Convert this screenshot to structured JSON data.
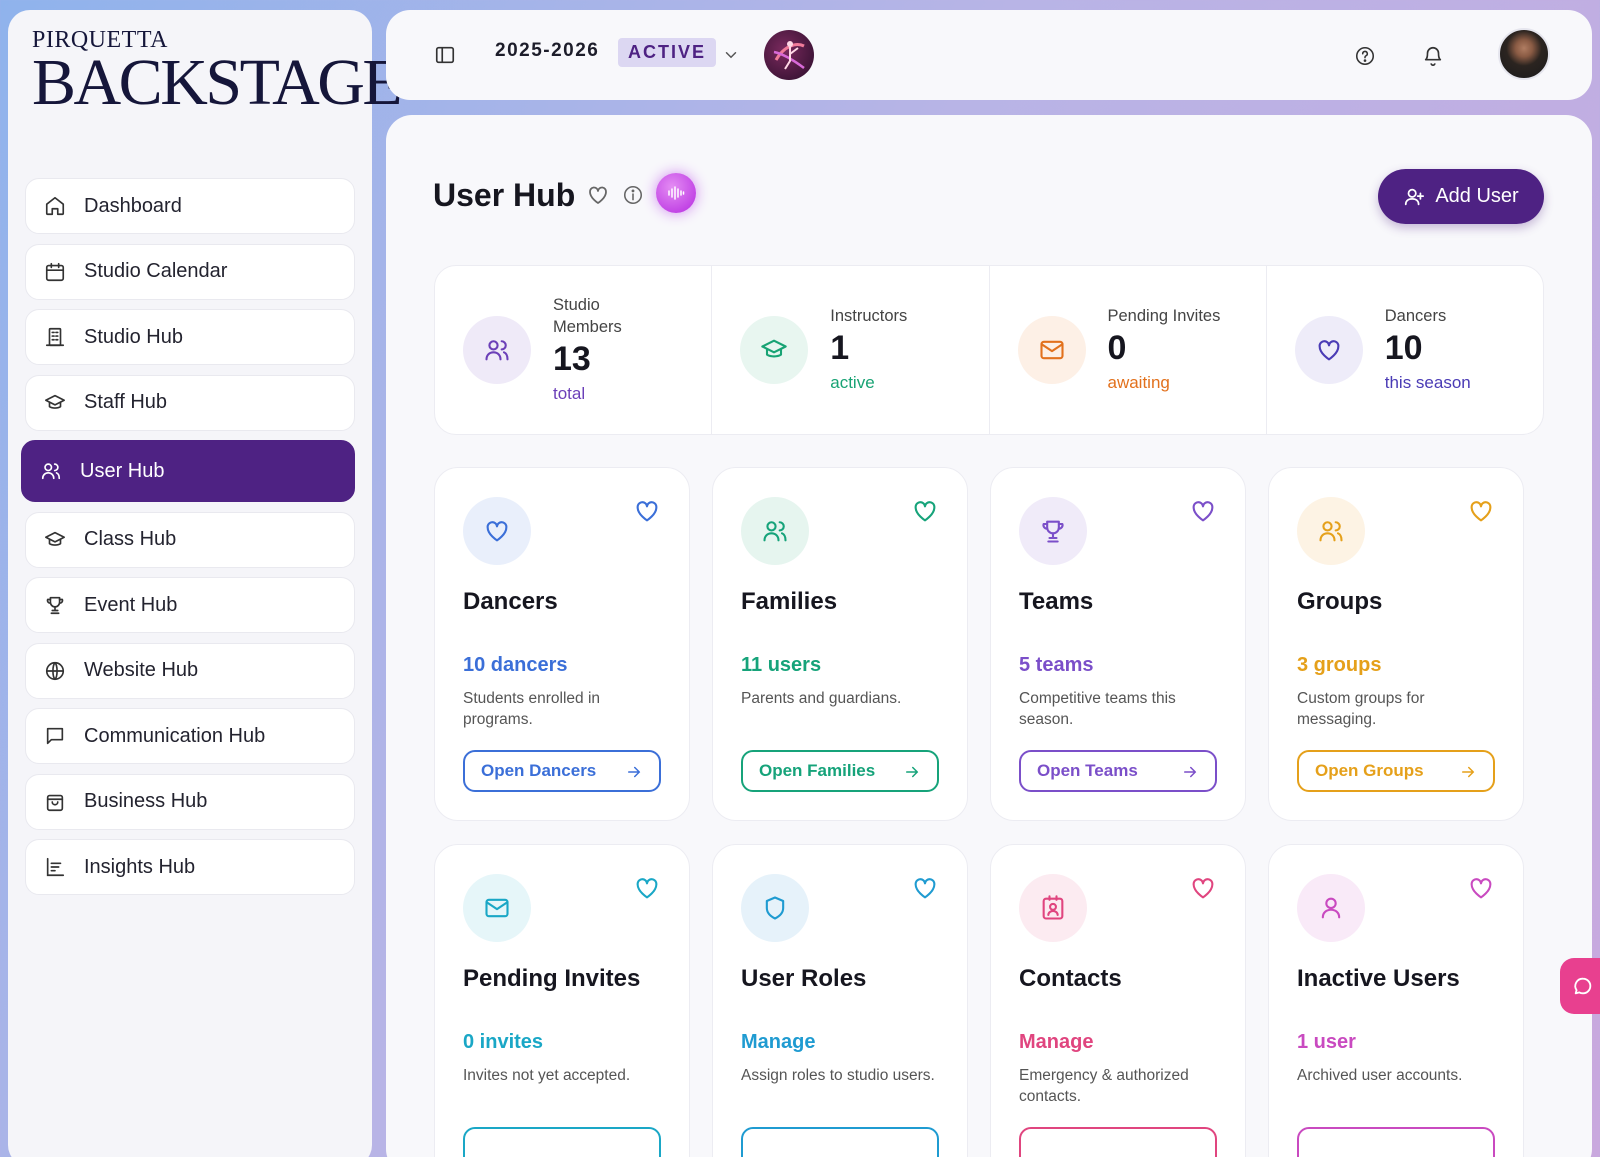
{
  "brand": {
    "line1": "PIRQUETTA",
    "line2": "BACKSTAGE"
  },
  "sidebar": {
    "items": [
      {
        "label": "Dashboard",
        "icon": "home-icon"
      },
      {
        "label": "Studio Calendar",
        "icon": "calendar-icon"
      },
      {
        "label": "Studio Hub",
        "icon": "building-icon"
      },
      {
        "label": "Staff Hub",
        "icon": "graduation-cap-icon"
      },
      {
        "label": "User Hub",
        "icon": "users-icon",
        "active": true
      },
      {
        "label": "Class Hub",
        "icon": "graduation-cap-icon"
      },
      {
        "label": "Event Hub",
        "icon": "trophy-icon"
      },
      {
        "label": "Website Hub",
        "icon": "globe-icon"
      },
      {
        "label": "Communication Hub",
        "icon": "message-square-icon"
      },
      {
        "label": "Business Hub",
        "icon": "shopping-bag-icon"
      },
      {
        "label": "Insights Hub",
        "icon": "bar-chart-icon"
      }
    ]
  },
  "topbar": {
    "season": "2025-2026",
    "status": "ACTIVE"
  },
  "page": {
    "title": "User Hub",
    "add_user_label": "Add User"
  },
  "stats": [
    {
      "label": "Studio Members",
      "value": "13",
      "sub": "total",
      "color": "#6b3fb8"
    },
    {
      "label": "Instructors",
      "value": "1",
      "sub": "active",
      "color": "#18a374"
    },
    {
      "label": "Pending Invites",
      "value": "0",
      "sub": "awaiting",
      "color": "#e2711d"
    },
    {
      "label": "Dancers",
      "value": "10",
      "sub": "this season",
      "color": "#4a3bb5"
    }
  ],
  "cards": [
    {
      "title": "Dancers",
      "count": "10 dancers",
      "desc": "Students enrolled in programs.",
      "button": "Open Dancers",
      "color": "#3b6fd8",
      "icon": "heart-icon"
    },
    {
      "title": "Families",
      "count": "11 users",
      "desc": "Parents and guardians.",
      "button": "Open Families",
      "color": "#16a37a",
      "icon": "users-icon"
    },
    {
      "title": "Teams",
      "count": "5 teams",
      "desc": "Competitive teams this season.",
      "button": "Open Teams",
      "color": "#7b4fc9",
      "icon": "trophy-icon"
    },
    {
      "title": "Groups",
      "count": "3 groups",
      "desc": "Custom groups for messaging.",
      "button": "Open Groups",
      "color": "#e5a01a",
      "icon": "users-icon"
    },
    {
      "title": "Pending Invites",
      "count": "0 invites",
      "desc": "Invites not yet accepted.",
      "button": "",
      "color": "#1aa7c6",
      "icon": "mail-icon"
    },
    {
      "title": "User Roles",
      "count": "Manage",
      "desc": "Assign roles to studio users.",
      "button": "",
      "color": "#1f9bd1",
      "icon": "shield-icon"
    },
    {
      "title": "Contacts",
      "count": "Manage",
      "desc": "Emergency & authorized contacts.",
      "button": "",
      "color": "#e0457f",
      "icon": "contact-card-icon"
    },
    {
      "title": "Inactive Users",
      "count": "1 user",
      "desc": "Archived user accounts.",
      "button": "",
      "color": "#c94ac0",
      "icon": "user-icon"
    }
  ]
}
